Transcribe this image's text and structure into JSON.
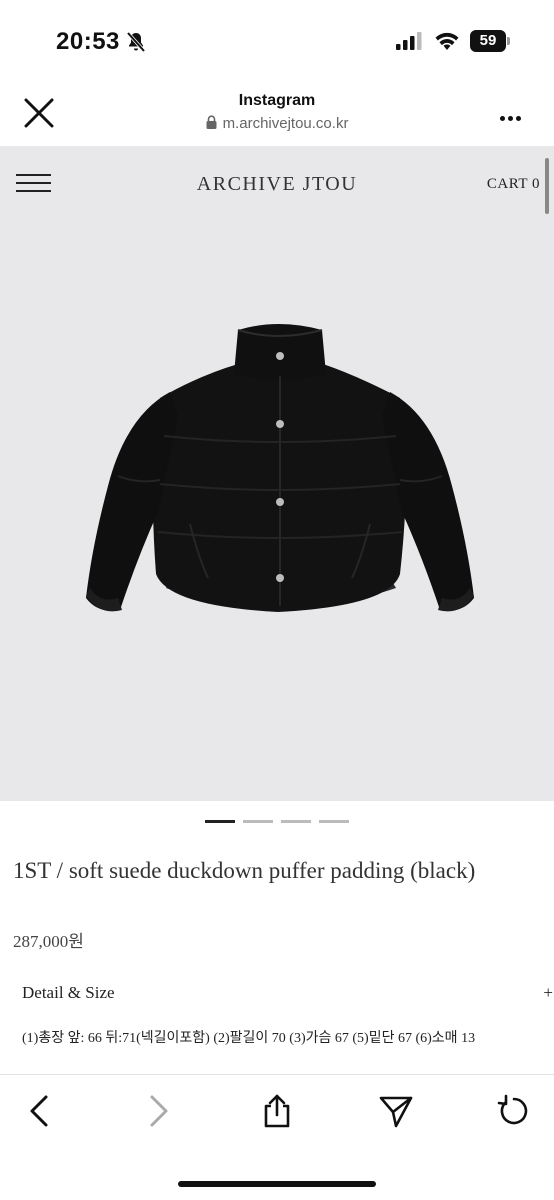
{
  "status_bar": {
    "time": "20:53",
    "battery": "59",
    "icons": [
      "bell-slash-icon",
      "signal-icon",
      "wifi-icon",
      "battery-icon"
    ]
  },
  "browser": {
    "title": "Instagram",
    "url": "m.archivejtou.co.kr",
    "icons": [
      "close-icon",
      "lock-icon",
      "more-icon"
    ]
  },
  "site": {
    "brand": "ARCHIVE JTOU",
    "cart_label": "CART",
    "cart_count": "0",
    "icons": [
      "menu-icon"
    ]
  },
  "product": {
    "name": "1ST / soft suede duckdown puffer padding (black)",
    "price": "287,000원",
    "detail_label": "Detail & Size",
    "detail_toggle": "+",
    "size_text": "(1)총장 앞: 66 뒤:71(넥길이포함) (2)팔길이 70 (3)가슴 67 (5)밑단 67 (6)소매 13",
    "image_count": 4,
    "active_image": 1
  },
  "toolbar": {
    "icons": [
      "back-icon",
      "forward-icon",
      "share-icon",
      "send-icon",
      "reload-icon"
    ]
  }
}
